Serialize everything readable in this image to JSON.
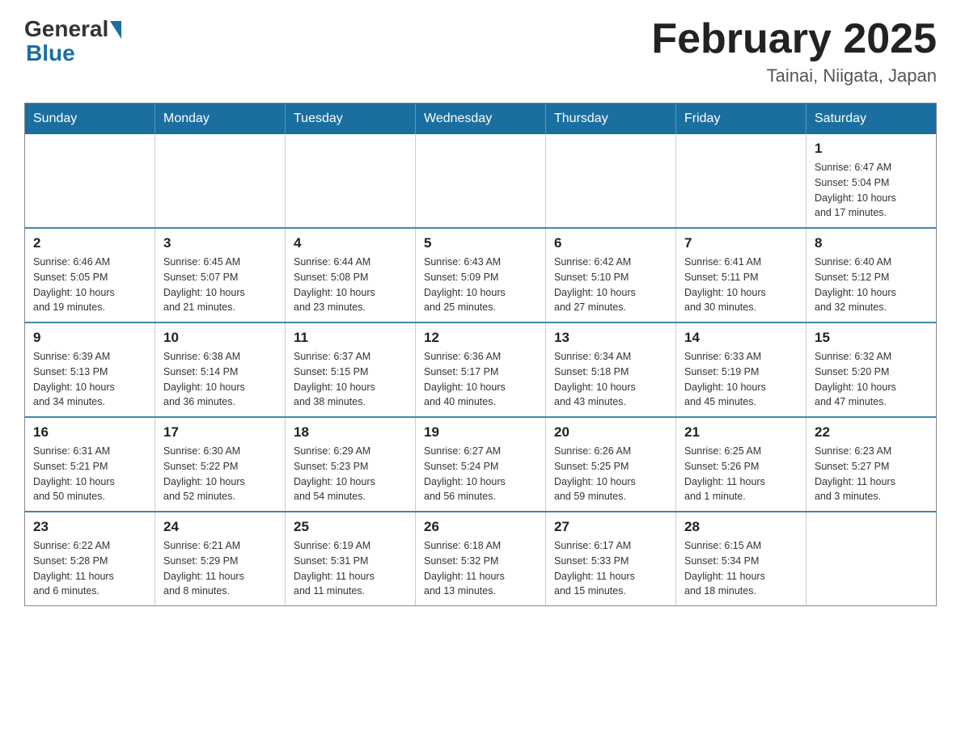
{
  "header": {
    "logo_general": "General",
    "logo_blue": "Blue",
    "title": "February 2025",
    "subtitle": "Tainai, Niigata, Japan"
  },
  "weekdays": [
    "Sunday",
    "Monday",
    "Tuesday",
    "Wednesday",
    "Thursday",
    "Friday",
    "Saturday"
  ],
  "weeks": [
    [
      {
        "day": "",
        "info": ""
      },
      {
        "day": "",
        "info": ""
      },
      {
        "day": "",
        "info": ""
      },
      {
        "day": "",
        "info": ""
      },
      {
        "day": "",
        "info": ""
      },
      {
        "day": "",
        "info": ""
      },
      {
        "day": "1",
        "info": "Sunrise: 6:47 AM\nSunset: 5:04 PM\nDaylight: 10 hours\nand 17 minutes."
      }
    ],
    [
      {
        "day": "2",
        "info": "Sunrise: 6:46 AM\nSunset: 5:05 PM\nDaylight: 10 hours\nand 19 minutes."
      },
      {
        "day": "3",
        "info": "Sunrise: 6:45 AM\nSunset: 5:07 PM\nDaylight: 10 hours\nand 21 minutes."
      },
      {
        "day": "4",
        "info": "Sunrise: 6:44 AM\nSunset: 5:08 PM\nDaylight: 10 hours\nand 23 minutes."
      },
      {
        "day": "5",
        "info": "Sunrise: 6:43 AM\nSunset: 5:09 PM\nDaylight: 10 hours\nand 25 minutes."
      },
      {
        "day": "6",
        "info": "Sunrise: 6:42 AM\nSunset: 5:10 PM\nDaylight: 10 hours\nand 27 minutes."
      },
      {
        "day": "7",
        "info": "Sunrise: 6:41 AM\nSunset: 5:11 PM\nDaylight: 10 hours\nand 30 minutes."
      },
      {
        "day": "8",
        "info": "Sunrise: 6:40 AM\nSunset: 5:12 PM\nDaylight: 10 hours\nand 32 minutes."
      }
    ],
    [
      {
        "day": "9",
        "info": "Sunrise: 6:39 AM\nSunset: 5:13 PM\nDaylight: 10 hours\nand 34 minutes."
      },
      {
        "day": "10",
        "info": "Sunrise: 6:38 AM\nSunset: 5:14 PM\nDaylight: 10 hours\nand 36 minutes."
      },
      {
        "day": "11",
        "info": "Sunrise: 6:37 AM\nSunset: 5:15 PM\nDaylight: 10 hours\nand 38 minutes."
      },
      {
        "day": "12",
        "info": "Sunrise: 6:36 AM\nSunset: 5:17 PM\nDaylight: 10 hours\nand 40 minutes."
      },
      {
        "day": "13",
        "info": "Sunrise: 6:34 AM\nSunset: 5:18 PM\nDaylight: 10 hours\nand 43 minutes."
      },
      {
        "day": "14",
        "info": "Sunrise: 6:33 AM\nSunset: 5:19 PM\nDaylight: 10 hours\nand 45 minutes."
      },
      {
        "day": "15",
        "info": "Sunrise: 6:32 AM\nSunset: 5:20 PM\nDaylight: 10 hours\nand 47 minutes."
      }
    ],
    [
      {
        "day": "16",
        "info": "Sunrise: 6:31 AM\nSunset: 5:21 PM\nDaylight: 10 hours\nand 50 minutes."
      },
      {
        "day": "17",
        "info": "Sunrise: 6:30 AM\nSunset: 5:22 PM\nDaylight: 10 hours\nand 52 minutes."
      },
      {
        "day": "18",
        "info": "Sunrise: 6:29 AM\nSunset: 5:23 PM\nDaylight: 10 hours\nand 54 minutes."
      },
      {
        "day": "19",
        "info": "Sunrise: 6:27 AM\nSunset: 5:24 PM\nDaylight: 10 hours\nand 56 minutes."
      },
      {
        "day": "20",
        "info": "Sunrise: 6:26 AM\nSunset: 5:25 PM\nDaylight: 10 hours\nand 59 minutes."
      },
      {
        "day": "21",
        "info": "Sunrise: 6:25 AM\nSunset: 5:26 PM\nDaylight: 11 hours\nand 1 minute."
      },
      {
        "day": "22",
        "info": "Sunrise: 6:23 AM\nSunset: 5:27 PM\nDaylight: 11 hours\nand 3 minutes."
      }
    ],
    [
      {
        "day": "23",
        "info": "Sunrise: 6:22 AM\nSunset: 5:28 PM\nDaylight: 11 hours\nand 6 minutes."
      },
      {
        "day": "24",
        "info": "Sunrise: 6:21 AM\nSunset: 5:29 PM\nDaylight: 11 hours\nand 8 minutes."
      },
      {
        "day": "25",
        "info": "Sunrise: 6:19 AM\nSunset: 5:31 PM\nDaylight: 11 hours\nand 11 minutes."
      },
      {
        "day": "26",
        "info": "Sunrise: 6:18 AM\nSunset: 5:32 PM\nDaylight: 11 hours\nand 13 minutes."
      },
      {
        "day": "27",
        "info": "Sunrise: 6:17 AM\nSunset: 5:33 PM\nDaylight: 11 hours\nand 15 minutes."
      },
      {
        "day": "28",
        "info": "Sunrise: 6:15 AM\nSunset: 5:34 PM\nDaylight: 11 hours\nand 18 minutes."
      },
      {
        "day": "",
        "info": ""
      }
    ]
  ]
}
